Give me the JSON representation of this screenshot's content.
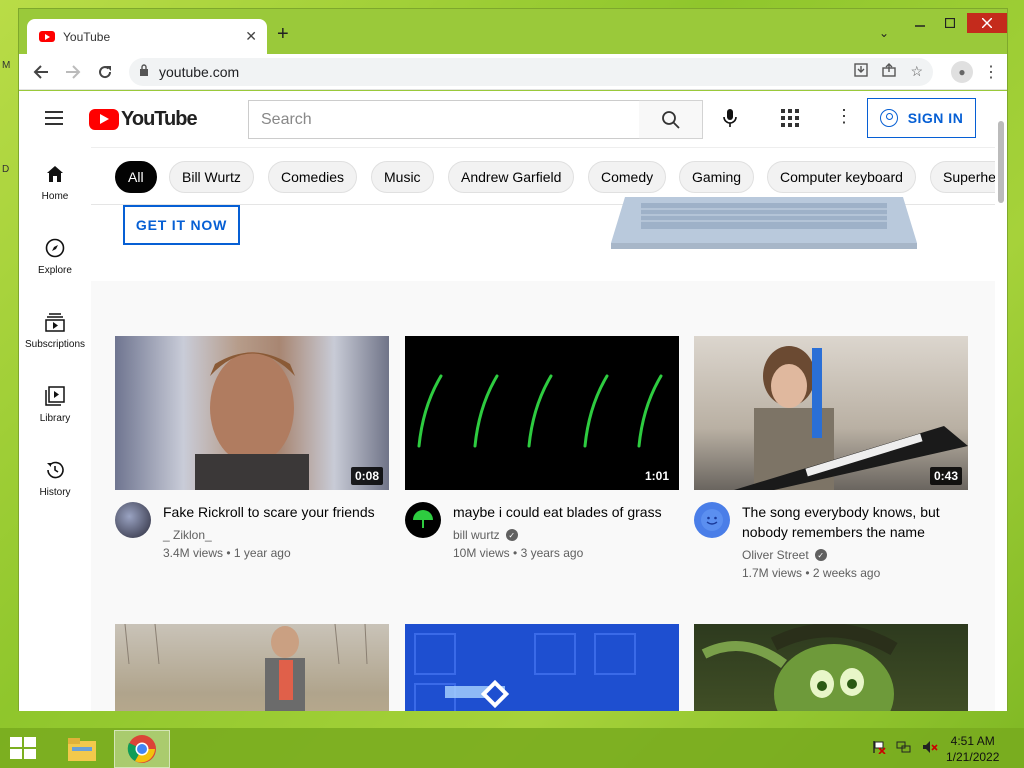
{
  "browser": {
    "tab_title": "YouTube",
    "tab_close": "✕",
    "new_tab": "+",
    "url": "youtube.com"
  },
  "youtube": {
    "logo_text": "YouTube",
    "search_placeholder": "Search",
    "sign_in": "SIGN IN",
    "sidebar": [
      {
        "label": "Home",
        "icon": "home-icon"
      },
      {
        "label": "Explore",
        "icon": "compass-icon"
      },
      {
        "label": "Subscriptions",
        "icon": "subscriptions-icon"
      },
      {
        "label": "Library",
        "icon": "library-icon"
      },
      {
        "label": "History",
        "icon": "history-icon"
      }
    ],
    "chips": [
      "All",
      "Bill Wurtz",
      "Comedies",
      "Music",
      "Andrew Garfield",
      "Comedy",
      "Gaming",
      "Computer keyboard",
      "Superhe"
    ],
    "banner_button": "GET IT NOW",
    "videos": [
      {
        "title": "Fake Rickroll to scare your friends",
        "channel": "_ Ziklon_",
        "verified": false,
        "views": "3.4M views",
        "age": "1 year ago",
        "duration": "0:08"
      },
      {
        "title": "maybe i could eat blades of grass",
        "channel": "bill wurtz",
        "verified": true,
        "views": "10M views",
        "age": "3 years ago",
        "duration": "1:01"
      },
      {
        "title": "The song everybody knows, but nobody remembers the name",
        "channel": "Oliver Street",
        "verified": true,
        "views": "1.7M views",
        "age": "2 weeks ago",
        "duration": "0:43"
      }
    ]
  },
  "taskbar": {
    "time": "4:51 AM",
    "date": "1/21/2022"
  },
  "colors": {
    "accent_blue": "#065fd4",
    "yt_red": "#ff0000",
    "desktop_green": "#a6d23a"
  }
}
